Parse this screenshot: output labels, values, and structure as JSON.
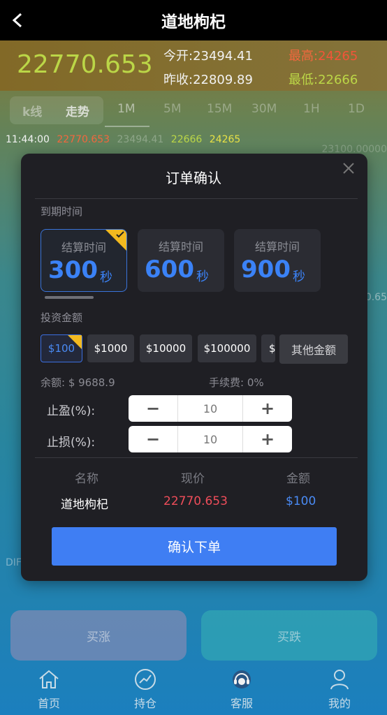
{
  "header": {
    "title": "道地枸杞"
  },
  "quote": {
    "price": "22770.653",
    "open_label": "今开:",
    "open": "23494.41",
    "prev_label": "昨收:",
    "prev": "22809.89",
    "high_label": "最高:",
    "high": "24265",
    "low_label": "最低:",
    "low": "22666"
  },
  "chart_tabs": {
    "kline": "k线",
    "trend": "走势",
    "frames": [
      "1M",
      "5M",
      "15M",
      "30M",
      "1H",
      "1D"
    ]
  },
  "ticker": {
    "time": "11:44:00",
    "values": [
      "22770.653",
      "23494.41",
      "22666",
      "24265"
    ],
    "axis_top": "23100.00000",
    "axis_side": "0.65",
    "side_label": "DIF"
  },
  "modal": {
    "title": "订单确认",
    "expiry_label": "到期时间",
    "time_caption": "结算时间",
    "time_unit": "秒",
    "times": [
      "300",
      "600",
      "900"
    ],
    "amount_label": "投资金额",
    "amounts": [
      "$100",
      "$1000",
      "$10000",
      "$100000",
      "$"
    ],
    "other_amount": "其他金额",
    "balance": "余额: $ 9688.9",
    "fee": "手续费: 0%",
    "take_profit_label": "止盈(%):",
    "take_profit": "10",
    "stop_loss_label": "止损(%):",
    "stop_loss": "10",
    "col_name": "名称",
    "col_price": "现价",
    "col_amount": "金额",
    "row_name": "道地枸杞",
    "row_price": "22770.653",
    "row_amount": "$100",
    "confirm": "确认下单"
  },
  "actions": {
    "buy_up": "买涨",
    "buy_down": "买跌"
  },
  "nav": [
    {
      "label": "首页",
      "icon": "home-icon"
    },
    {
      "label": "持仓",
      "icon": "chart-icon"
    },
    {
      "label": "客服",
      "icon": "support-icon"
    },
    {
      "label": "我的",
      "icon": "user-icon"
    }
  ],
  "colors": {
    "accent": "#3f7ef3",
    "up": "#ff5a3c",
    "down": "#c6e24b",
    "badge": "#f2b91f"
  }
}
